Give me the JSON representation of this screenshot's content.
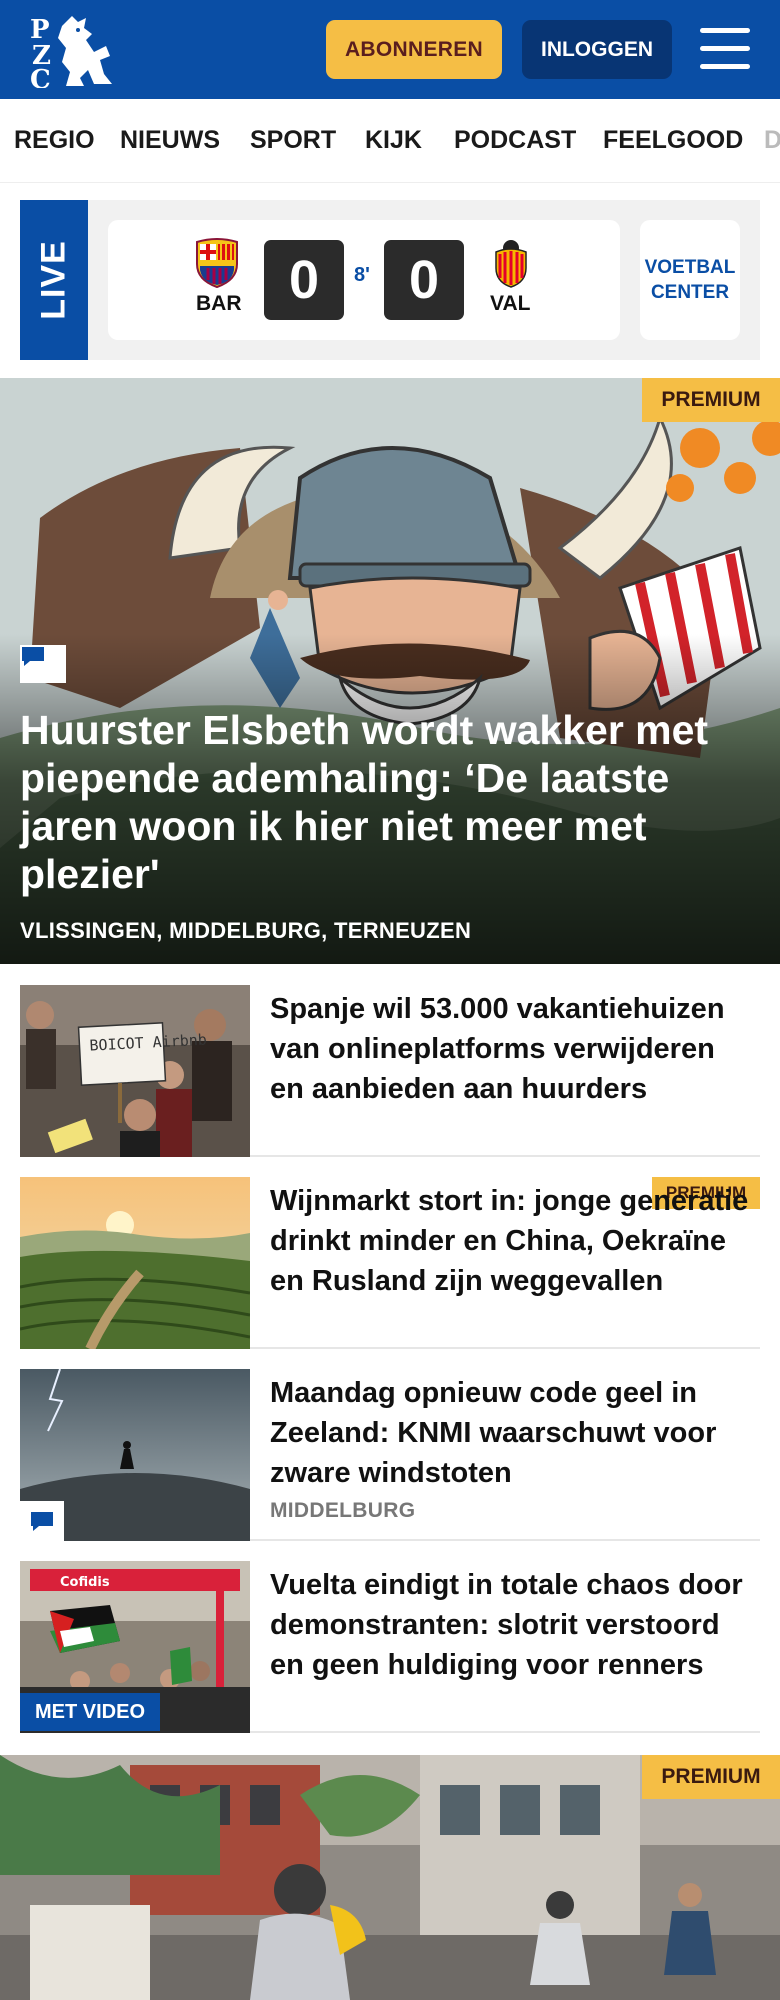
{
  "header": {
    "brand": "PZC",
    "subscribe_label": "ABONNEREN",
    "login_label": "INLOGGEN",
    "colors": {
      "primary": "#0a4ea5",
      "accent": "#f5be45",
      "dark": "#083574"
    }
  },
  "nav": {
    "items": [
      {
        "label": "REGIO"
      },
      {
        "label": "NIEUWS"
      },
      {
        "label": "SPORT"
      },
      {
        "label": "KIJK"
      },
      {
        "label": "PODCAST"
      },
      {
        "label": "FEELGOOD"
      },
      {
        "label": "D"
      }
    ]
  },
  "live": {
    "label": "LIVE",
    "home_team": "BAR",
    "away_team": "VAL",
    "home_score": "0",
    "away_score": "0",
    "minute": "8'",
    "center_label": "VOETBAL CENTER"
  },
  "hero": {
    "premium_label": "PREMIUM",
    "title": "Huurster Elsbeth wordt wakker met piepende ademhaling: ‘De laatste jaren woon ik hier niet meer met plezier'",
    "location": "VLISSINGEN, MIDDELBURG, TERNEUZEN",
    "icon": "comment-icon"
  },
  "articles": [
    {
      "title": "Spanje wil 53.000 vakantiehuizen van onlineplatforms verwijderen en aanbieden aan huurders",
      "sign_text": "BOICOT Airbnb"
    },
    {
      "title": "Wijnmarkt stort in: jonge generatie drinkt minder en China, Oekraïne en Rusland zijn weggevallen",
      "premium_label": "PREMIUM"
    },
    {
      "title": "Maandag opnieuw code geel in Zeeland: KNMI waarschuwt voor zware windstoten",
      "location": "MIDDELBURG",
      "icon": "comment-icon"
    },
    {
      "title": "Vuelta eindigt in totale chaos door demonstranten: slotrit verstoord en geen huldiging voor renners",
      "video_label": "MET VIDEO",
      "banner_text": "Cofidis"
    }
  ],
  "bottom": {
    "premium_label": "PREMIUM"
  }
}
